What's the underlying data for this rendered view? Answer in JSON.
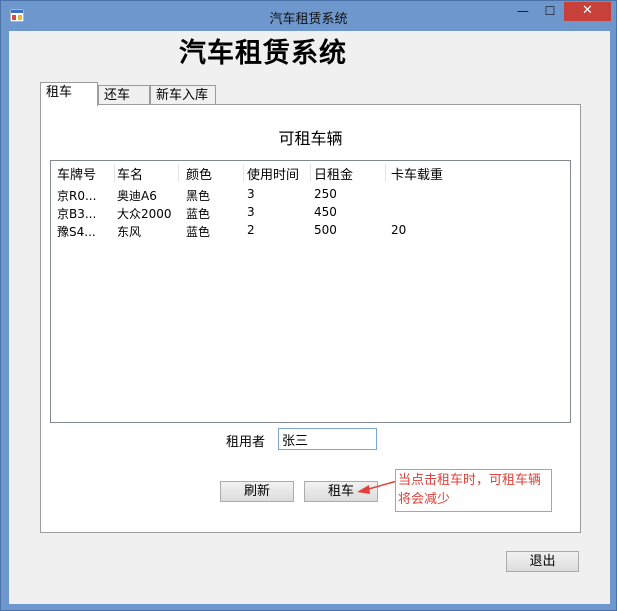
{
  "window": {
    "title": "汽车租赁系统",
    "min_glyph": "—",
    "max_glyph": "☐",
    "close_glyph": "✕"
  },
  "header": {
    "big_title": "汽车租赁系统"
  },
  "tabs": [
    {
      "label": "租车",
      "active": true
    },
    {
      "label": "还车",
      "active": false
    },
    {
      "label": "新车入库",
      "active": false
    }
  ],
  "panel": {
    "title": "可租车辆",
    "columns": [
      "车牌号",
      "车名",
      "颜色",
      "使用时间",
      "日租金",
      "卡车载重"
    ],
    "rows": [
      [
        "京R0...",
        "奥迪A6",
        "黑色",
        "3",
        "250",
        ""
      ],
      [
        "京B3...",
        "大众2000",
        "蓝色",
        "3",
        "450",
        ""
      ],
      [
        "豫S4...",
        "东风",
        "蓝色",
        "2",
        "500",
        "20"
      ]
    ],
    "renter_label": "租用者",
    "renter_value": "张三",
    "refresh_label": "刷新",
    "rent_label": "租车",
    "annotation": "当点击租车时，可租车辆将会减少"
  },
  "footer": {
    "exit_label": "退出"
  },
  "colors": {
    "close": "#c7413a",
    "annotation_text": "#e0413a",
    "annotation_border": "#5bc3cf"
  }
}
